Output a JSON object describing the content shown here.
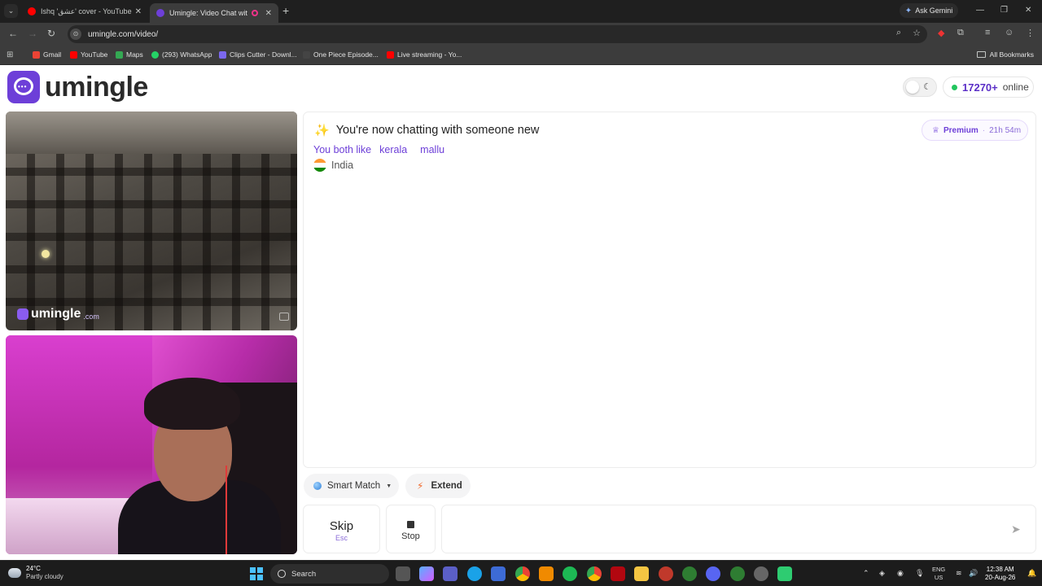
{
  "browser": {
    "tabs": [
      {
        "title": "Ishq 'عشق' cover - YouTube",
        "favicon_color": "#ff0000"
      },
      {
        "title": "Umingle: Video Chat with St",
        "favicon_color": "#6d3fd8"
      }
    ],
    "ask_gemini": "Ask Gemini",
    "url": "umingle.com/video/",
    "bookmarks": [
      {
        "label": "Gmail",
        "color": "#ea4335"
      },
      {
        "label": "YouTube",
        "color": "#ff0000"
      },
      {
        "label": "Maps",
        "color": "#34a853"
      },
      {
        "label": "(293) WhatsApp",
        "color": "#25d366"
      },
      {
        "label": "Clips Cutter - Downl...",
        "color": "#7b68ee"
      },
      {
        "label": "One Piece Episode...",
        "color": "#222222"
      },
      {
        "label": "Live streaming - Yo...",
        "color": "#ff0000"
      }
    ],
    "all_bookmarks": "All Bookmarks"
  },
  "header": {
    "brand": "umingle",
    "online_count": "17270+",
    "online_label": "online"
  },
  "remote_video": {
    "watermark": "umingle",
    "watermark_suffix": ".com"
  },
  "chat": {
    "title": "You're now chatting with someone new",
    "likes_label": "You both like",
    "tags": [
      "kerala",
      "mallu"
    ],
    "country": "India",
    "premium_label": "Premium",
    "premium_sep": "·",
    "premium_time": "21h 54m"
  },
  "controls": {
    "smart_match": "Smart Match",
    "extend": "Extend",
    "skip": "Skip",
    "skip_key": "Esc",
    "stop": "Stop",
    "message_placeholder": ""
  },
  "taskbar": {
    "temp": "24°C",
    "weather": "Partly cloudy",
    "search": "Search",
    "lang_top": "ENG",
    "lang_bottom": "US",
    "time": "12:38 AM",
    "date": "20-Aug-26"
  },
  "colors": {
    "accent": "#6d3fd8",
    "online_dot": "#22c55e"
  }
}
